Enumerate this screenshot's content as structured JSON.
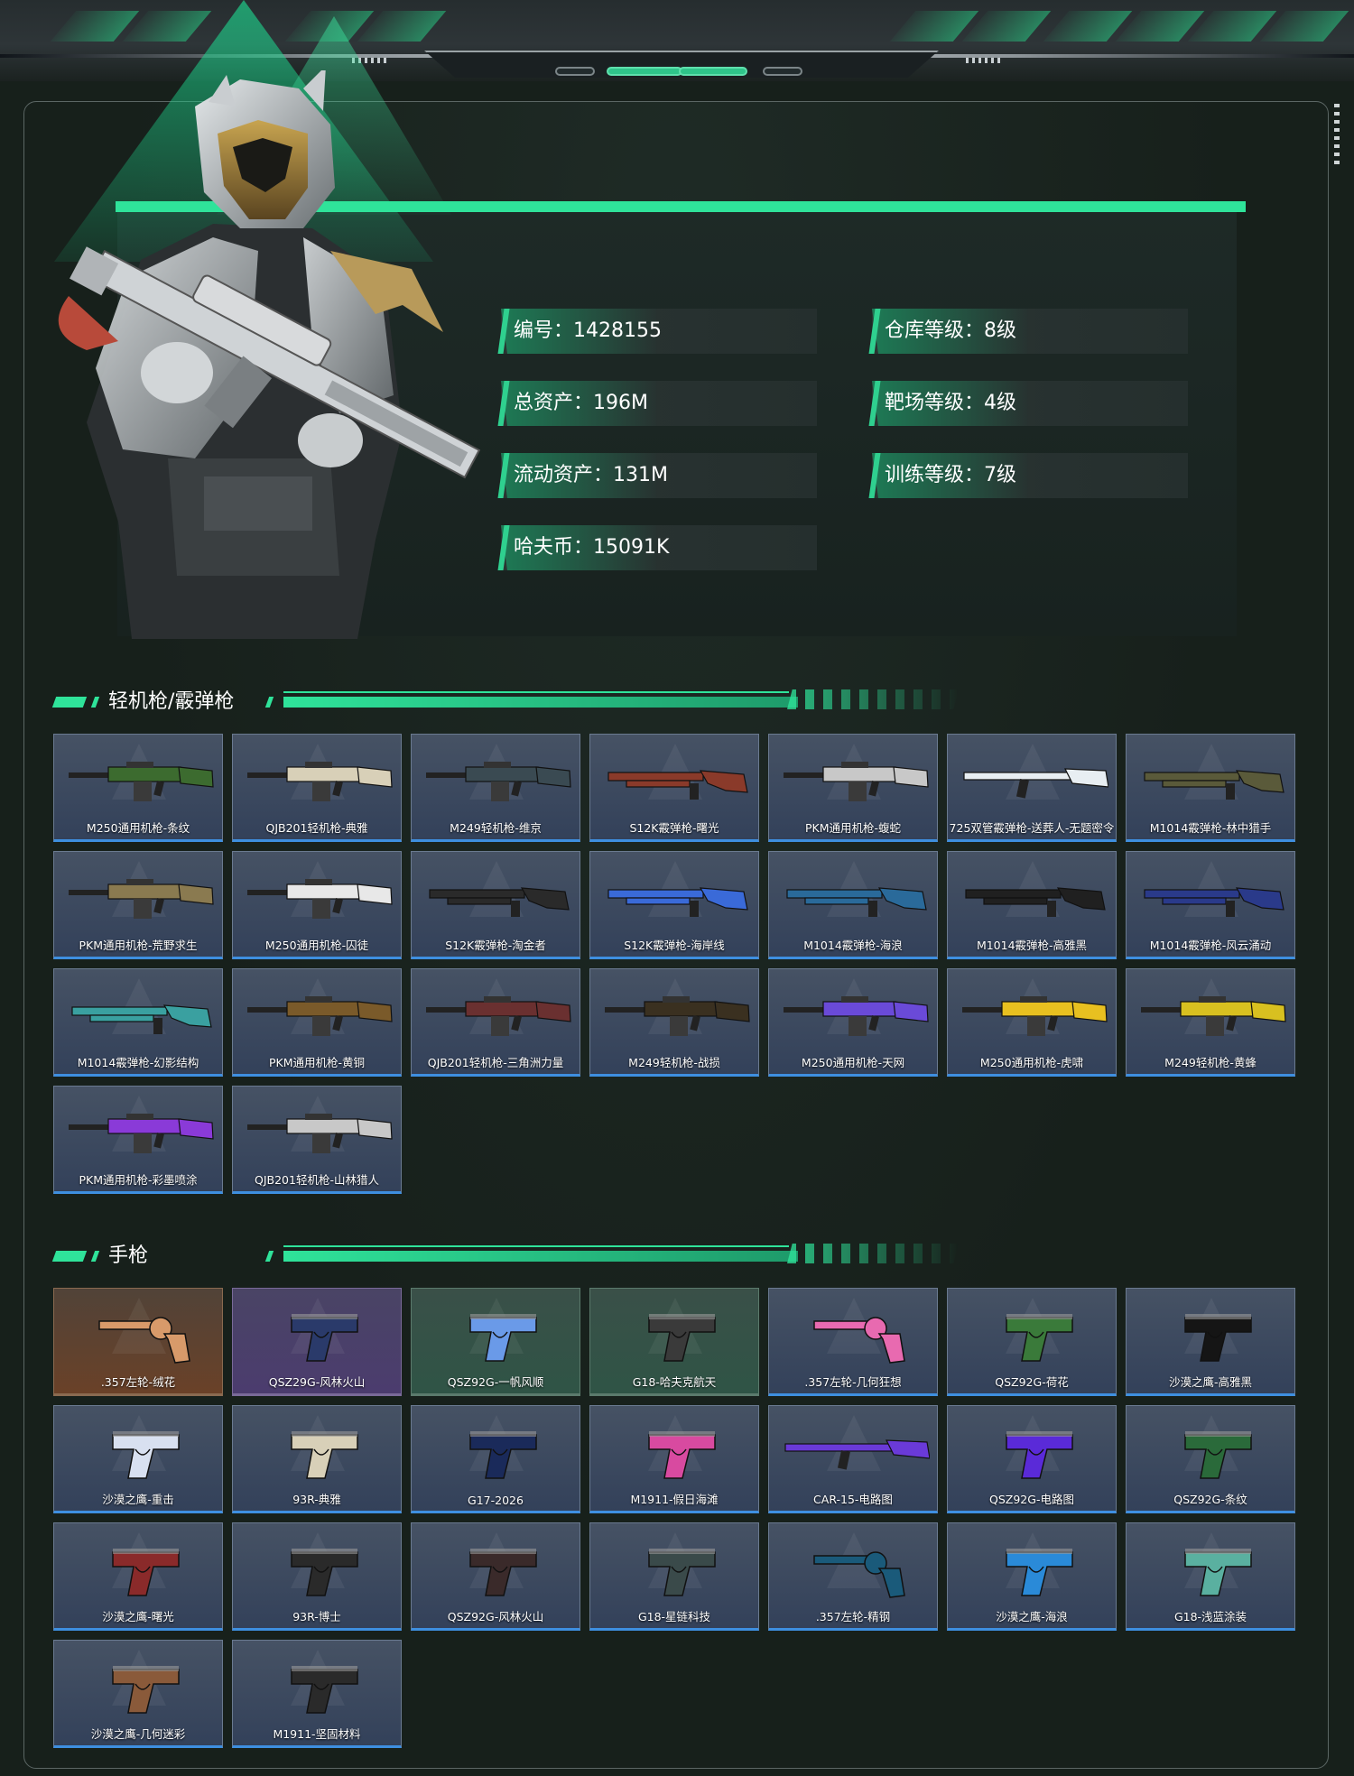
{
  "profile": {
    "stats": [
      {
        "label": "编号",
        "value": "1428155"
      },
      {
        "label": "仓库等级",
        "value": "8级"
      },
      {
        "label": "总资产",
        "value": "196M"
      },
      {
        "label": "靶场等级",
        "value": "4级"
      },
      {
        "label": "流动资产",
        "value": "131M"
      },
      {
        "label": "训练等级",
        "value": "7级"
      },
      {
        "label": "哈夫币",
        "value": "15091K"
      }
    ]
  },
  "sections": [
    {
      "title": "轻机枪/霰弹枪",
      "items": [
        {
          "name": "M250通用机枪-条纹",
          "rarity": "blue",
          "kind": "lmg",
          "color": "#3c6b2f"
        },
        {
          "name": "QJB201轻机枪-典雅",
          "rarity": "blue",
          "kind": "lmg",
          "color": "#d8d0b8"
        },
        {
          "name": "M249轻机枪-维京",
          "rarity": "blue",
          "kind": "lmg",
          "color": "#3a4a52"
        },
        {
          "name": "S12K霰弹枪-曙光",
          "rarity": "blue",
          "kind": "shotgun",
          "color": "#8a3a2a"
        },
        {
          "name": "PKM通用机枪-蝮蛇",
          "rarity": "blue",
          "kind": "lmg",
          "color": "#c8c8c8"
        },
        {
          "name": "725双管霰弹枪-送葬人-无题密令",
          "rarity": "blue",
          "kind": "rifle",
          "color": "#e8eef2"
        },
        {
          "name": "M1014霰弹枪-林中猎手",
          "rarity": "blue",
          "kind": "shotgun",
          "color": "#5a5a3a"
        },
        {
          "name": "PKM通用机枪-荒野求生",
          "rarity": "blue",
          "kind": "lmg",
          "color": "#8a7a50"
        },
        {
          "name": "M250通用机枪-囚徒",
          "rarity": "blue",
          "kind": "lmg",
          "color": "#e8e8e8"
        },
        {
          "name": "S12K霰弹枪-淘金者",
          "rarity": "blue",
          "kind": "shotgun",
          "color": "#2a2a2a"
        },
        {
          "name": "S12K霰弹枪-海岸线",
          "rarity": "blue",
          "kind": "shotgun",
          "color": "#3a6ad8"
        },
        {
          "name": "M1014霰弹枪-海浪",
          "rarity": "blue",
          "kind": "shotgun",
          "color": "#2a6a9a"
        },
        {
          "name": "M1014霰弹枪-高雅黑",
          "rarity": "blue",
          "kind": "shotgun",
          "color": "#202020"
        },
        {
          "name": "M1014霰弹枪-风云涌动",
          "rarity": "blue",
          "kind": "shotgun",
          "color": "#2a3a8a"
        },
        {
          "name": "M1014霰弹枪-幻影结构",
          "rarity": "blue",
          "kind": "shotgun",
          "color": "#3aa0a0"
        },
        {
          "name": "PKM通用机枪-黄铜",
          "rarity": "blue",
          "kind": "lmg",
          "color": "#7a5a2a"
        },
        {
          "name": "QJB201轻机枪-三角洲力量",
          "rarity": "blue",
          "kind": "lmg",
          "color": "#6a3030"
        },
        {
          "name": "M249轻机枪-战损",
          "rarity": "blue",
          "kind": "lmg",
          "color": "#3a3020"
        },
        {
          "name": "M250通用机枪-天网",
          "rarity": "blue",
          "kind": "lmg",
          "color": "#6a4ad8"
        },
        {
          "name": "M250通用机枪-虎啸",
          "rarity": "blue",
          "kind": "lmg",
          "color": "#e8c020"
        },
        {
          "name": "M249轻机枪-黄蜂",
          "rarity": "blue",
          "kind": "lmg",
          "color": "#d8c020"
        },
        {
          "name": "PKM通用机枪-彩墨喷涂",
          "rarity": "blue",
          "kind": "lmg",
          "color": "#8a3ad8"
        },
        {
          "name": "QJB201轻机枪-山林猎人",
          "rarity": "blue",
          "kind": "lmg",
          "color": "#c8c8c8"
        }
      ]
    },
    {
      "title": "手枪",
      "items": [
        {
          "name": ".357左轮-绒花",
          "rarity": "orange",
          "kind": "revolver",
          "color": "#d89a6a"
        },
        {
          "name": "QSZ29G-风林火山",
          "rarity": "purple",
          "kind": "pistol",
          "color": "#2a3a6a"
        },
        {
          "name": "QSZ92G-一帆风顺",
          "rarity": "green",
          "kind": "pistol",
          "color": "#6a9ae8"
        },
        {
          "name": "G18-哈夫克航天",
          "rarity": "green",
          "kind": "pistol",
          "color": "#3a3a3a"
        },
        {
          "name": ".357左轮-几何狂想",
          "rarity": "blue",
          "kind": "revolver",
          "color": "#e86ab0"
        },
        {
          "name": "QSZ92G-荷花",
          "rarity": "blue",
          "kind": "pistol",
          "color": "#3a7a3a"
        },
        {
          "name": "沙漠之鹰-高雅黑",
          "rarity": "blue",
          "kind": "pistol",
          "color": "#151515"
        },
        {
          "name": "沙漠之鹰-重击",
          "rarity": "blue",
          "kind": "pistol",
          "color": "#d8e0f0"
        },
        {
          "name": "93R-典雅",
          "rarity": "blue",
          "kind": "pistol",
          "color": "#d8d0b8"
        },
        {
          "name": "G17-2026",
          "rarity": "blue",
          "kind": "pistol",
          "color": "#1a2a5a"
        },
        {
          "name": "M1911-假日海滩",
          "rarity": "blue",
          "kind": "pistol",
          "color": "#d84aa0"
        },
        {
          "name": "CAR-15-电路图",
          "rarity": "blue",
          "kind": "rifle",
          "color": "#6a3ad8"
        },
        {
          "name": "QSZ92G-电路图",
          "rarity": "blue",
          "kind": "pistol",
          "color": "#5a2ad8"
        },
        {
          "name": "QSZ92G-条纹",
          "rarity": "blue",
          "kind": "pistol",
          "color": "#2a6a3a"
        },
        {
          "name": "沙漠之鹰-曙光",
          "rarity": "blue",
          "kind": "pistol",
          "color": "#8a2a2a"
        },
        {
          "name": "93R-博士",
          "rarity": "blue",
          "kind": "pistol",
          "color": "#2a2a2a"
        },
        {
          "name": "QSZ92G-风林火山",
          "rarity": "blue",
          "kind": "pistol",
          "color": "#3a2a2a"
        },
        {
          "name": "G18-星链科技",
          "rarity": "blue",
          "kind": "pistol",
          "color": "#3a4a4a"
        },
        {
          "name": ".357左轮-精钢",
          "rarity": "blue",
          "kind": "revolver",
          "color": "#1a5a7a"
        },
        {
          "name": "沙漠之鹰-海浪",
          "rarity": "blue",
          "kind": "pistol",
          "color": "#2a8ad8"
        },
        {
          "name": "G18-浅蓝涂装",
          "rarity": "blue",
          "kind": "pistol",
          "color": "#5ab0a0"
        },
        {
          "name": "沙漠之鹰-几何迷彩",
          "rarity": "blue",
          "kind": "pistol",
          "color": "#8a5a3a"
        },
        {
          "name": "M1911-坚固材料",
          "rarity": "blue",
          "kind": "pistol",
          "color": "#2a2a2a"
        }
      ]
    }
  ]
}
